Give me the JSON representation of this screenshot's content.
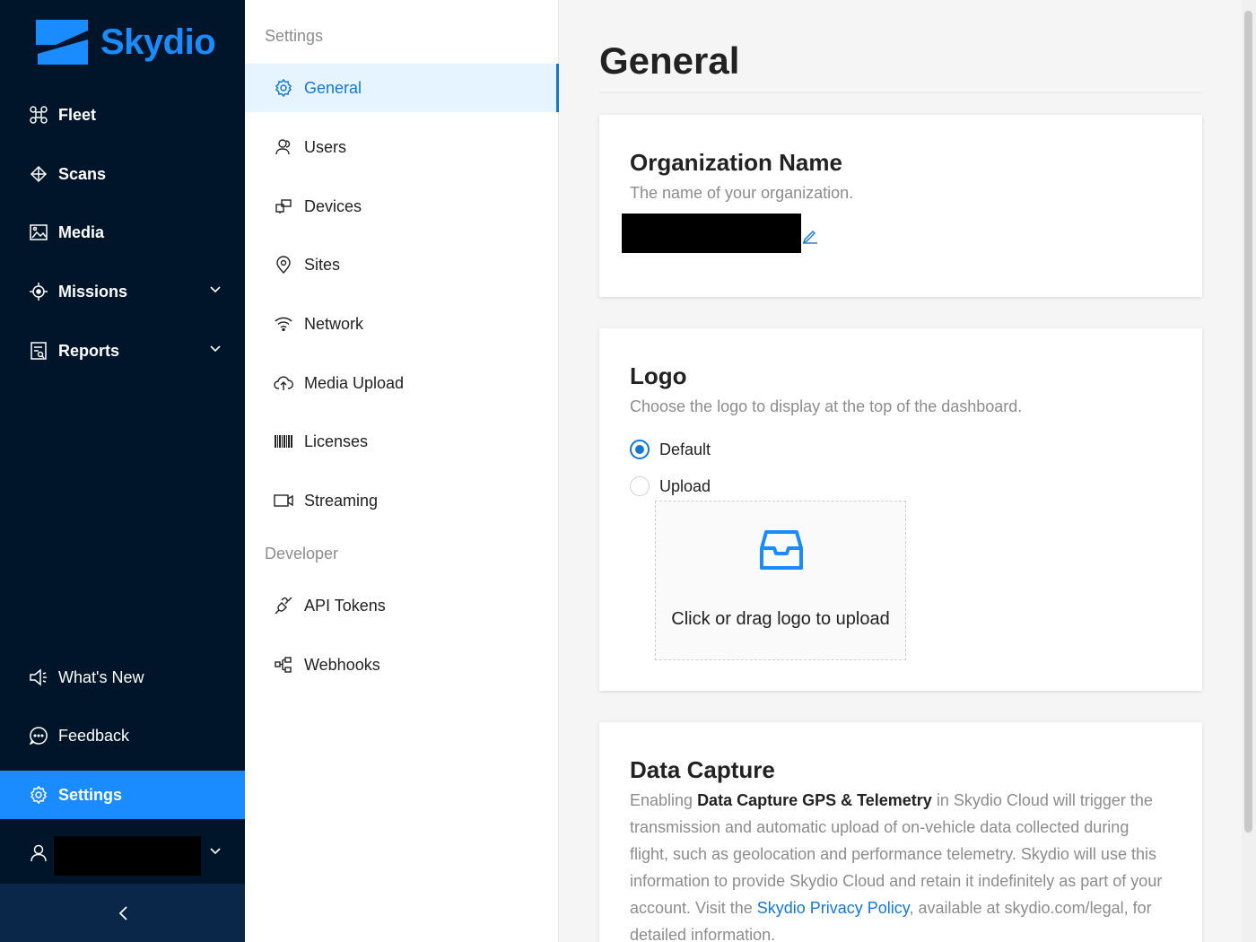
{
  "brand": {
    "name": "Skydio",
    "color": "#1a8cff"
  },
  "nav": {
    "items": [
      {
        "label": "Fleet",
        "icon": "drone-icon"
      },
      {
        "label": "Scans",
        "icon": "cube-icon"
      },
      {
        "label": "Media",
        "icon": "image-icon"
      },
      {
        "label": "Missions",
        "icon": "target-icon",
        "expandable": true
      },
      {
        "label": "Reports",
        "icon": "report-icon",
        "expandable": true
      }
    ],
    "bottom_items": [
      {
        "label": "What's New",
        "icon": "megaphone-icon"
      },
      {
        "label": "Feedback",
        "icon": "chat-icon"
      },
      {
        "label": "Settings",
        "icon": "gear-icon",
        "active": true
      }
    ],
    "user": {
      "name_redacted": true,
      "icon": "user-icon"
    },
    "collapse_icon": "chevron-left-icon"
  },
  "submenu": {
    "settings_heading": "Settings",
    "settings_items": [
      {
        "label": "General",
        "icon": "gear-icon",
        "active": true
      },
      {
        "label": "Users",
        "icon": "users-icon"
      },
      {
        "label": "Devices",
        "icon": "devices-icon"
      },
      {
        "label": "Sites",
        "icon": "location-pin-icon"
      },
      {
        "label": "Network",
        "icon": "wifi-icon"
      },
      {
        "label": "Media Upload",
        "icon": "cloud-upload-icon"
      },
      {
        "label": "Licenses",
        "icon": "barcode-icon"
      },
      {
        "label": "Streaming",
        "icon": "video-camera-icon"
      }
    ],
    "developer_heading": "Developer",
    "developer_items": [
      {
        "label": "API Tokens",
        "icon": "api-icon"
      },
      {
        "label": "Webhooks",
        "icon": "webhook-icon"
      }
    ]
  },
  "main": {
    "title": "General",
    "org": {
      "heading": "Organization Name",
      "description": "The name of your organization.",
      "value_redacted": true
    },
    "logo": {
      "heading": "Logo",
      "description": "Choose the logo to display at the top of the dashboard.",
      "options": [
        {
          "label": "Default",
          "checked": true
        },
        {
          "label": "Upload",
          "checked": false
        }
      ],
      "upload_text": "Click or drag logo to upload"
    },
    "data_capture": {
      "heading": "Data Capture",
      "p1": "Enabling ",
      "bold": "Data Capture GPS & Telemetry",
      "p2": " in Skydio Cloud will trigger the transmission and automatic upload of on-vehicle data collected during flight, such as geolocation and performance telemetry. Skydio will use this information to provide Skydio Cloud and retain it indefinitely as part of your account. Visit the ",
      "link": "Skydio Privacy Policy",
      "p3": ", available at skydio.com/legal, for detailed information."
    }
  }
}
